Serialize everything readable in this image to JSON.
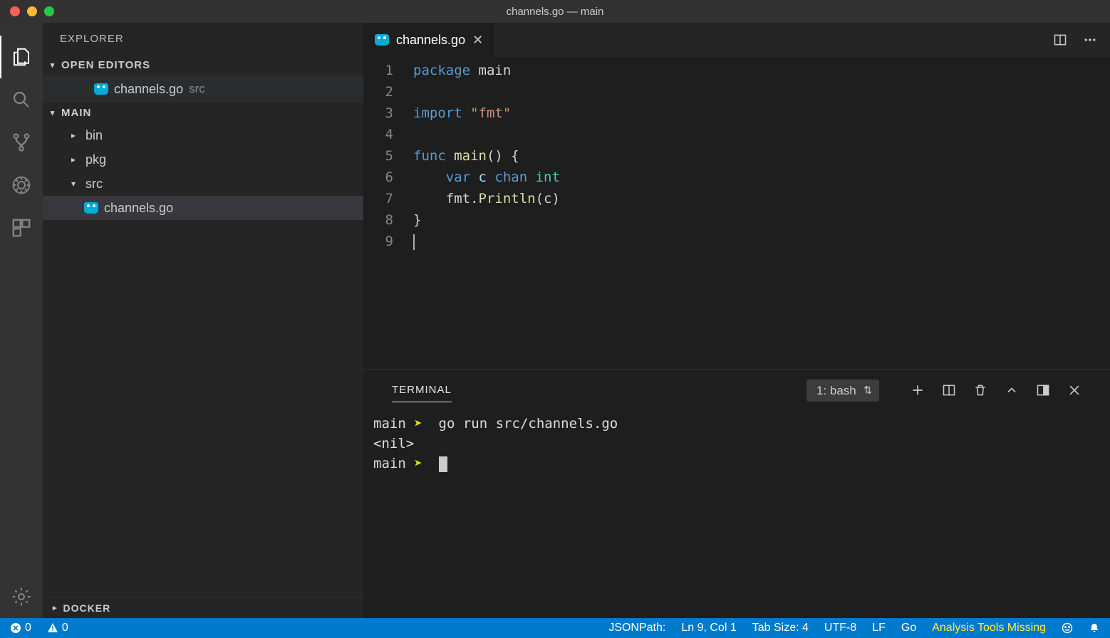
{
  "window": {
    "title": "channels.go — main"
  },
  "sidebar": {
    "title": "EXPLORER",
    "sections": {
      "openEditors": {
        "label": "OPEN EDITORS"
      },
      "workspace": {
        "label": "MAIN"
      },
      "docker": {
        "label": "DOCKER"
      }
    },
    "openEditorItem": {
      "name": "channels.go",
      "dir": "src"
    },
    "tree": {
      "bin": "bin",
      "pkg": "pkg",
      "src": "src",
      "file": "channels.go"
    }
  },
  "editor": {
    "tab": {
      "name": "channels.go"
    },
    "lines": [
      "1",
      "2",
      "3",
      "4",
      "5",
      "6",
      "7",
      "8",
      "9"
    ],
    "code": {
      "l1a": "package",
      "l1b": " main",
      "l3a": "import",
      "l3b": " \"fmt\"",
      "l5a": "func",
      "l5b": " main",
      "l5c": "() {",
      "l6a": "    var",
      "l6b": " c ",
      "l6c": "chan",
      "l6d": " int",
      "l7a": "    fmt.",
      "l7b": "Println",
      "l7c": "(c)",
      "l8": "}"
    }
  },
  "terminal": {
    "tab": "TERMINAL",
    "shell": "1: bash",
    "lines": {
      "p1cwd": "main",
      "p1arrow": "➤",
      "p1cmd": "  go run src/channels.go",
      "out1": "<nil>",
      "p2cwd": "main",
      "p2arrow": "➤"
    }
  },
  "status": {
    "errors": "0",
    "warnings": "0",
    "jsonpath": "JSONPath:",
    "pos": "Ln 9, Col 1",
    "tab": "Tab Size: 4",
    "enc": "UTF-8",
    "eol": "LF",
    "lang": "Go",
    "analysis": "Analysis Tools Missing"
  }
}
